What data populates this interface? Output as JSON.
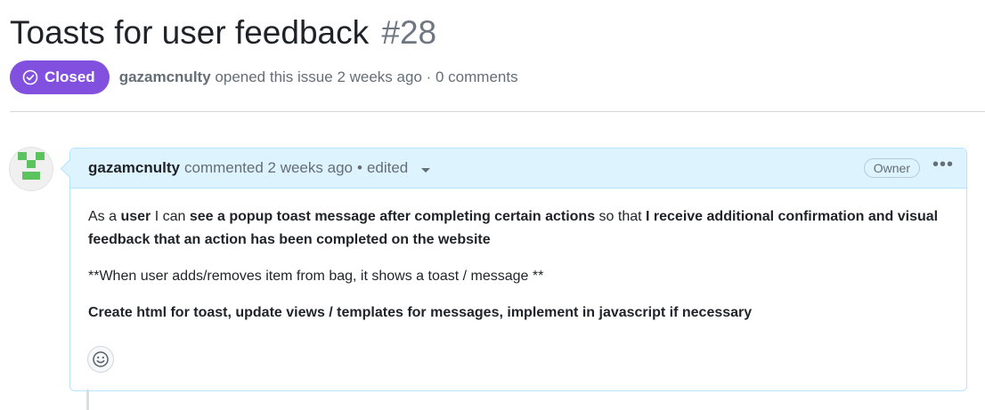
{
  "issue": {
    "title": "Toasts for user feedback",
    "number": "#28",
    "state_label": "Closed",
    "state_color": "#8250df",
    "author": "gazamcnulty",
    "opened_text": "opened this issue 2 weeks ago · 0 comments"
  },
  "comment": {
    "author": "gazamcnulty",
    "action_text": "commented 2 weeks ago",
    "separator": "•",
    "edited_label": "edited",
    "role_badge": "Owner",
    "menu_icon": "kebab-horizontal-icon",
    "body": {
      "p1_t1": "As a ",
      "p1_b1": "user",
      "p1_t2": " I can ",
      "p1_b2": "see a popup toast message after completing certain actions",
      "p1_t3": " so that ",
      "p1_b3": "I receive additional confirmation and visual feedback that an action has been completed on the website",
      "p2": "**When user adds/removes item from bag, it shows a toast / message **",
      "p3": "Create html for toast, update views / templates for messages, implement in javascript if necessary"
    },
    "reaction_icon": "smiley-icon"
  },
  "colors": {
    "header_bg": "#ddf4ff",
    "border": "#b6e3ff",
    "avatar_green": "#5cc45f"
  }
}
